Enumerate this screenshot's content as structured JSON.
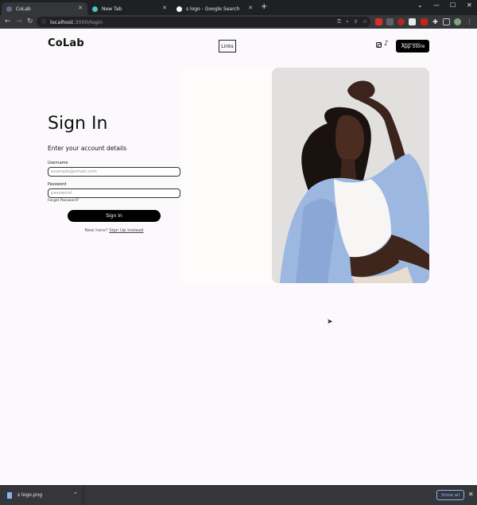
{
  "browser": {
    "tabs": [
      {
        "title": "CoLab",
        "active": true
      },
      {
        "title": "New Tab",
        "active": false
      },
      {
        "title": "s logo - Google Search",
        "active": false
      }
    ],
    "new_tab_glyph": "+",
    "url_host": "localhost",
    "url_path": ":3000/login",
    "window_controls": [
      "⌄",
      "—",
      "☐",
      "✕"
    ]
  },
  "header": {
    "logo": "CoLab",
    "links_label": "Links",
    "social_icons": [
      "instagram-icon",
      "tiktok-icon"
    ],
    "app_store_small": "Download on the",
    "app_store_big": "App Store"
  },
  "login": {
    "title": "Sign In",
    "subtitle": "Enter your account details",
    "username_label": "Username",
    "username_placeholder": "example@email.com",
    "password_label": "Password",
    "password_placeholder": "password",
    "forgot": "Forgot Password?",
    "submit": "Sign In",
    "new_here": "New here?",
    "signup": "Sign Up instead"
  },
  "download_bar": {
    "file_name": "s logo.png",
    "show_all": "Show all"
  },
  "colors": {
    "page_bg": "#fbf9fc",
    "button_bg": "#000000",
    "chrome_dark": "#35363a",
    "accent": "#8ab4f8"
  }
}
